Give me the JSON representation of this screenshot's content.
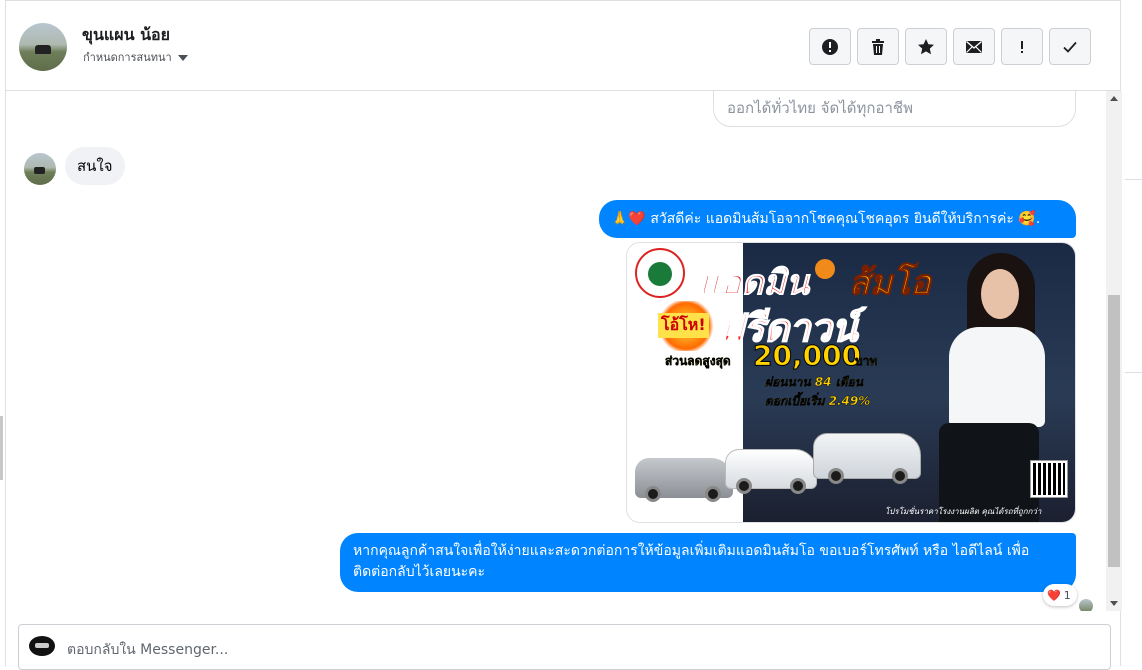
{
  "header": {
    "contact_name": "ขุนแผน น้อย",
    "assign_label": "กำหนดการสนทนา",
    "actions": [
      {
        "name": "spam-button",
        "icon": "exclamation-circle-icon"
      },
      {
        "name": "delete-button",
        "icon": "trash-icon"
      },
      {
        "name": "star-button",
        "icon": "star-icon"
      },
      {
        "name": "unread-button",
        "icon": "envelope-icon"
      },
      {
        "name": "important-button",
        "icon": "exclamation-icon"
      },
      {
        "name": "done-button",
        "icon": "check-icon"
      }
    ]
  },
  "thread": {
    "prev_bubble_text": "ออกได้ทั่วไทย จัดได้ทุกอาชีพ",
    "incoming_text": "สนใจ",
    "greeting_text": "🙏❤️ สวัสดีค่ะ แอดมินส้มโอจากโชคคุณโชคอุดร ยินดีให้บริการค่ะ 🥰.",
    "followup_text": "หากคุณลูกค้าสนใจเพื่อให้ง่ายและสะดวกต่อการให้ข้อมูลเพิ่มเติมแอดมินส้มโอ ขอเบอร์โทรศัพท์ หรือ ไอดีไลน์ เพื่อติดต่อกลับไว้เลยนะคะ",
    "reaction_emoji": "❤️",
    "reaction_count": "1"
  },
  "promo_image": {
    "title_admin": "แอดมิน",
    "title_som": "ส้มโอ",
    "badge": "โอ้โห!",
    "headline": "ฟรีดาวน์",
    "discount_label": "ส่วนลดสูงสุด",
    "discount_amount": "20,000",
    "discount_unit": "บาท",
    "installment": "ผ่อนนาน 84 เดือน",
    "rate": "ดอกเบี้ยเริ่ม 2.49%",
    "footer": "โปรโมชั่นราคาโรงงานผลิต คุณได้รถที่ถูกกว่า"
  },
  "composer": {
    "placeholder": "ตอบกลับใน Messenger..."
  },
  "colors": {
    "accent": "#0084ff",
    "incoming_bubble": "#f0f2f5"
  }
}
